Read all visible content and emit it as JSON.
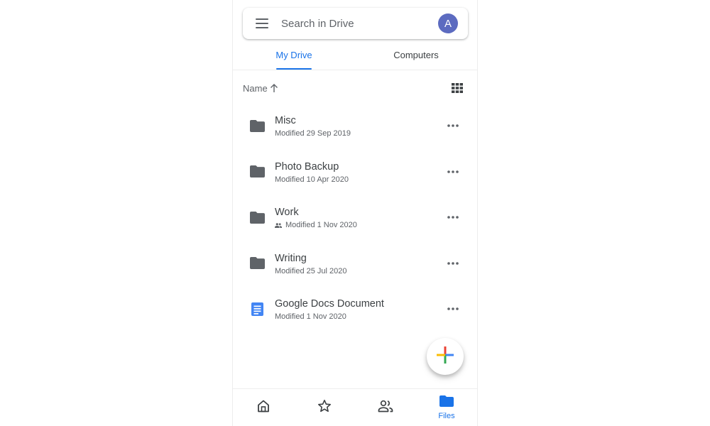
{
  "search": {
    "placeholder": "Search in Drive"
  },
  "avatar": {
    "initial": "A",
    "color": "#5c6bc0"
  },
  "tabs": [
    {
      "label": "My Drive",
      "active": true
    },
    {
      "label": "Computers",
      "active": false
    }
  ],
  "sort": {
    "label": "Name",
    "direction": "ascending"
  },
  "files": [
    {
      "name": "Misc",
      "type": "folder",
      "modified": "Modified 29 Sep 2019",
      "shared": false
    },
    {
      "name": "Photo Backup",
      "type": "folder",
      "modified": "Modified 10 Apr 2020",
      "shared": false
    },
    {
      "name": "Work",
      "type": "folder",
      "modified": "Modified 1 Nov 2020",
      "shared": true
    },
    {
      "name": "Writing",
      "type": "folder",
      "modified": "Modified 25 Jul 2020",
      "shared": false
    },
    {
      "name": "Google Docs Document",
      "type": "google-doc",
      "modified": "Modified 1 Nov 2020",
      "shared": false
    }
  ],
  "bottom_nav": [
    {
      "icon": "home-icon",
      "label": "",
      "active": false
    },
    {
      "icon": "star-icon",
      "label": "",
      "active": false
    },
    {
      "icon": "shared-people-icon",
      "label": "",
      "active": false
    },
    {
      "icon": "files-folder-icon",
      "label": "Files",
      "active": true
    }
  ],
  "colors": {
    "accent": "#1a73e8",
    "icon_grey": "#5f6368",
    "fab_plus": [
      "#4285f4",
      "#ea4335",
      "#fbbc04",
      "#34a853"
    ]
  }
}
